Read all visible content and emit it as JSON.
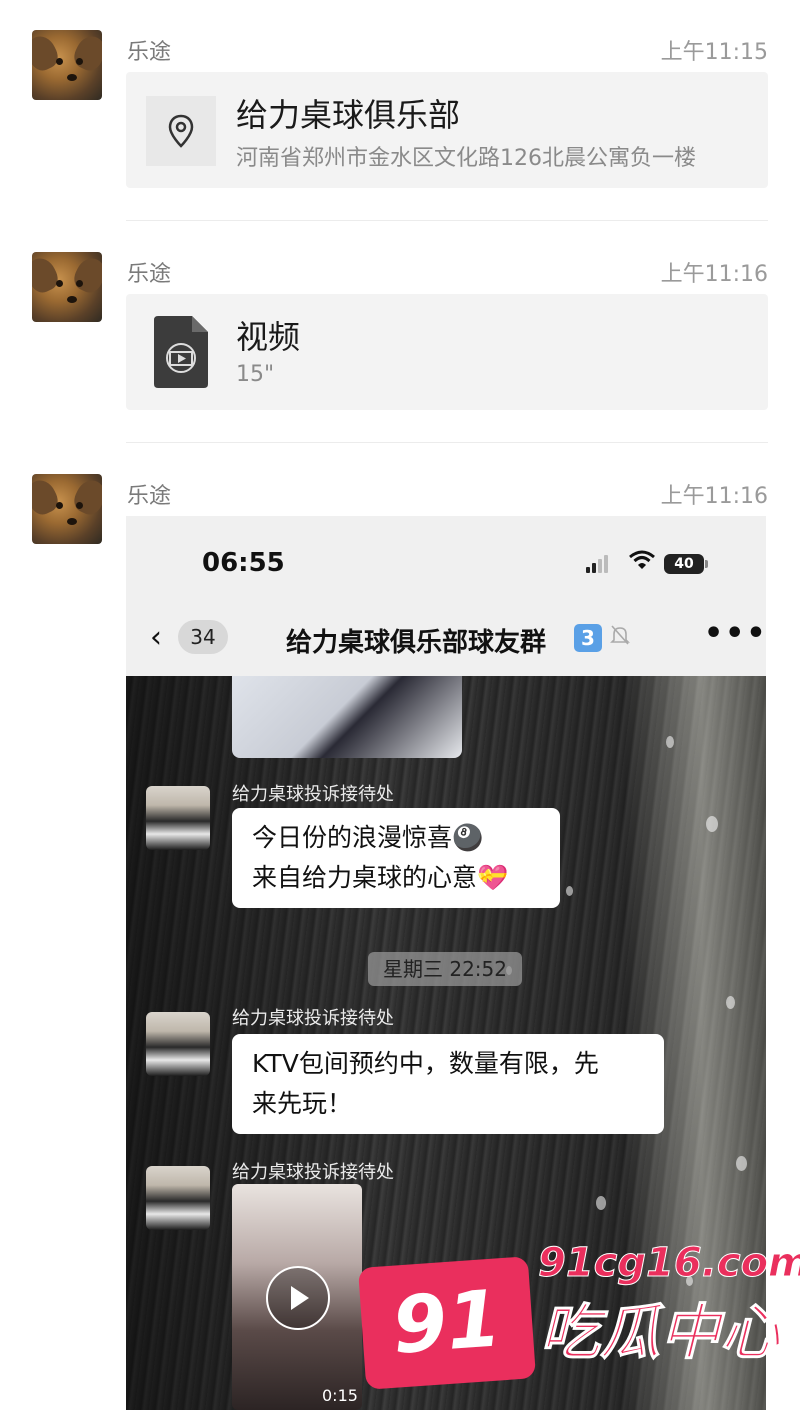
{
  "messages": [
    {
      "sender": "乐途",
      "time": "上午11:15",
      "card": {
        "type": "location",
        "title": "给力桌球俱乐部",
        "subtitle": "河南省郑州市金水区文化路126北晨公寓负一楼",
        "icon": "location-pin-icon"
      }
    },
    {
      "sender": "乐途",
      "time": "上午11:16",
      "card": {
        "type": "video-file",
        "title": "视频",
        "subtitle": "15\"",
        "icon": "video-file-icon"
      }
    },
    {
      "sender": "乐途",
      "time": "上午11:16",
      "image": {
        "status_time": "06:55",
        "battery": "40",
        "back_count": "34",
        "group_title": "给力桌球俱乐部球友群",
        "group_badge": "3",
        "more": "•••",
        "chat": [
          {
            "name": "给力桌球投诉接待处",
            "lines": [
              "今日份的浪漫惊喜🎱",
              "来自给力桌球的心意💝"
            ]
          },
          {
            "timestamp": "星期三 22:52"
          },
          {
            "name": "给力桌球投诉接待处",
            "lines": [
              "KTV包间预约中，数量有限，先",
              "来先玩！"
            ]
          },
          {
            "name": "给力桌球投诉接待处",
            "video_duration": "0:15"
          }
        ]
      }
    }
  ],
  "watermark": {
    "number": "91",
    "url": "91cg16.com",
    "text": "吃瓜中心",
    "color": "#ea2f5d"
  }
}
